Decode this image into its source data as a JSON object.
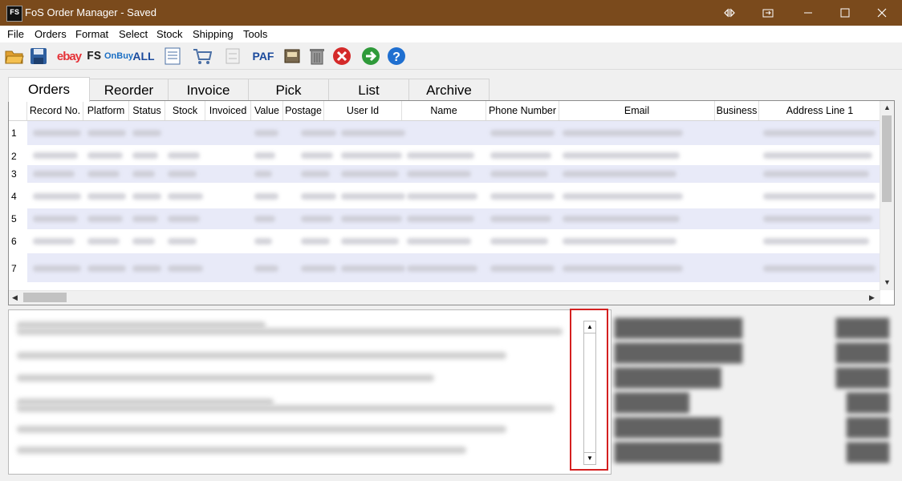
{
  "window": {
    "title": "FoS Order Manager - Saved",
    "app_icon_text": "FS"
  },
  "menu": [
    "File",
    "Orders",
    "Format",
    "Select",
    "Stock",
    "Shipping",
    "Tools"
  ],
  "toolbar": {
    "ebay_label": "ebay",
    "fs_label": "FS",
    "onbuy_label": "OnBuy",
    "all_label": "ALL",
    "paf_label": "PAF"
  },
  "tabs": [
    "Orders",
    "Reorder",
    "Invoice",
    "Pick",
    "List",
    "Archive"
  ],
  "grid": {
    "columns": [
      "Record No.",
      "Platform",
      "Status",
      "Stock",
      "Invoiced",
      "Value",
      "Postage",
      "User Id",
      "Name",
      "Phone Number",
      "Email",
      "Business",
      "Address Line 1"
    ],
    "row_numbers": [
      "1",
      "2",
      "3",
      "4",
      "5",
      "6",
      "7"
    ]
  },
  "colors": {
    "titlebar": "#7a4a1c",
    "highlight": "#d42020",
    "row_alt": "#e8eaf8"
  }
}
